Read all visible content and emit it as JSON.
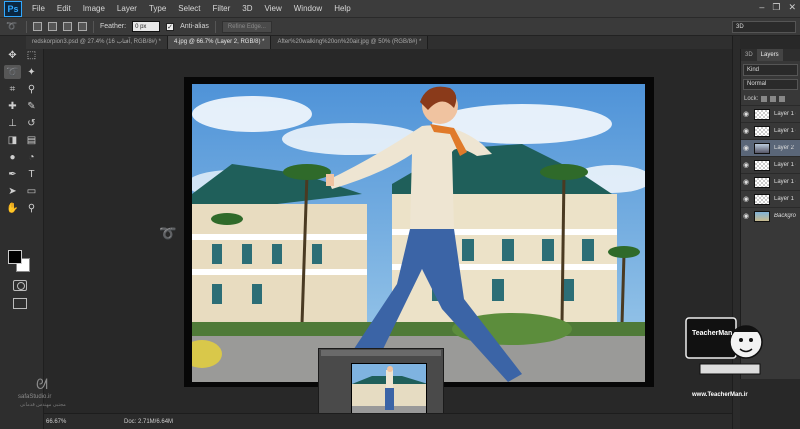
{
  "app": {
    "logo": "Ps",
    "window_controls": [
      "–",
      "❐",
      "✕"
    ]
  },
  "menu": [
    "File",
    "Edit",
    "Image",
    "Layer",
    "Type",
    "Select",
    "Filter",
    "3D",
    "View",
    "Window",
    "Help"
  ],
  "options": {
    "feather_label": "Feather:",
    "feather_value": "0 px",
    "antialias_label": "Anti-alias",
    "antialias_checked": true,
    "refine_edge_label": "Refine Edge...",
    "workspace": "3D"
  },
  "tabs": [
    {
      "label": "redskorpion3.psd @ 27.4% (آفتاب 16, RGB/8#) *",
      "active": false
    },
    {
      "label": "4.jpg @ 66.7% (Layer 2, RGB/8) *",
      "active": true
    },
    {
      "label": "After%20walking%20on%20air.jpg @ 50% (RGB/8#) *",
      "active": false
    }
  ],
  "tools": [
    "move-icon",
    "marquee-icon",
    "lasso-icon",
    "magic-wand-icon",
    "crop-icon",
    "eyedropper-icon",
    "healing-icon",
    "brush-icon",
    "stamp-icon",
    "history-brush-icon",
    "eraser-icon",
    "gradient-icon",
    "blur-icon",
    "dodge-icon",
    "pen-icon",
    "type-icon",
    "path-select-icon",
    "shape-icon",
    "hand-icon",
    "zoom-icon"
  ],
  "colors": {
    "foreground": "#000000",
    "background": "#ffffff",
    "accent": "#31a8ff"
  },
  "status": {
    "zoom": "66.67%",
    "doc_size": "Doc: 2.71M/6.64M"
  },
  "layers_panel": {
    "tabs": [
      "3D",
      "Layers"
    ],
    "filter": "Kind",
    "blend_mode": "Normal",
    "lock_label": "Lock:",
    "layers": [
      {
        "name": "Layer 1 c",
        "selected": false,
        "thumb": "transparent"
      },
      {
        "name": "Layer 1 c",
        "selected": false,
        "thumb": "transparent"
      },
      {
        "name": "Layer 2",
        "selected": true,
        "thumb": "figure"
      },
      {
        "name": "Layer 1 c",
        "selected": false,
        "thumb": "transparent"
      },
      {
        "name": "Layer 1 c",
        "selected": false,
        "thumb": "transparent"
      },
      {
        "name": "Layer 1",
        "selected": false,
        "thumb": "transparent"
      },
      {
        "name": "Background",
        "selected": false,
        "thumb": "background"
      }
    ]
  },
  "branding": {
    "logo_text": "TeacherMan",
    "url": "www.TeacherMan.ir",
    "studio": "safaStudio.ir",
    "studio_sub": "مجتبی مهندس قدمانی"
  }
}
